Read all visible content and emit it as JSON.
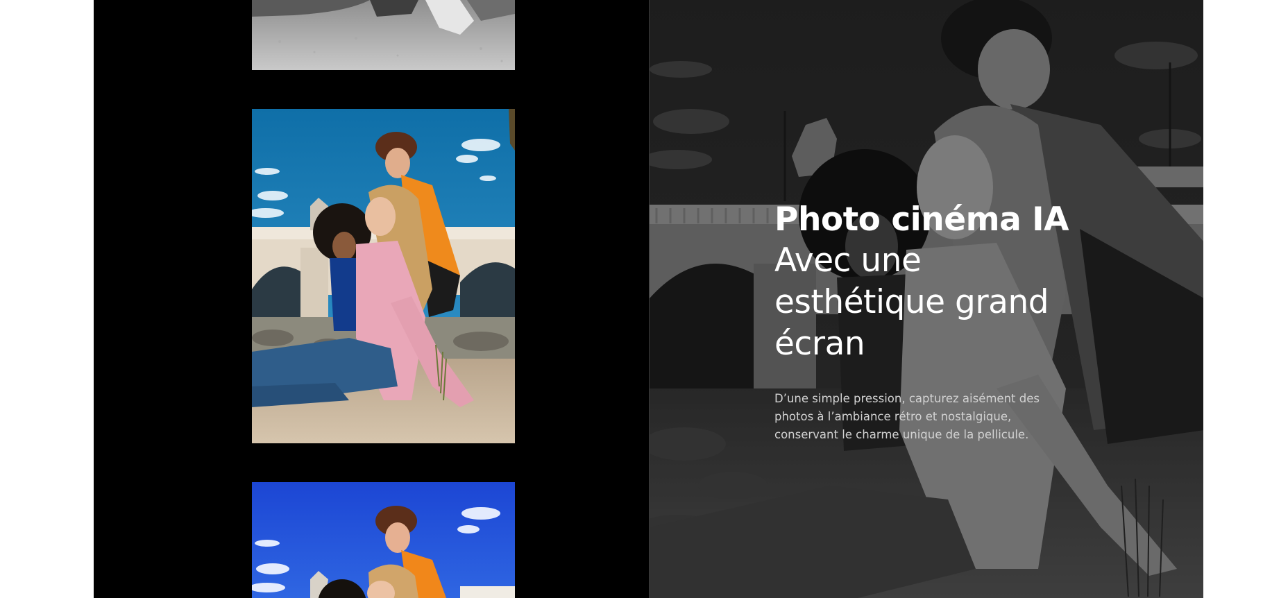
{
  "hero": {
    "title": "Photo cinéma IA",
    "subtitle": "Avec une esthétique grand écran",
    "description": "D’une simple pression, capturez aisément des photos à l’ambiance rétro et nostalgique, conservant le charme unique de la pellicule."
  },
  "filmstrip": {
    "frames": [
      {
        "style": "black-and-white"
      },
      {
        "style": "warm-color"
      },
      {
        "style": "vivid-blue"
      }
    ]
  },
  "colors": {
    "stage_background": "#000000",
    "page_background": "#ffffff",
    "title_text": "#ffffff",
    "description_text": "#d2d2d2",
    "sky_warm": "#1b84b9",
    "sky_vivid": "#1f4fd8",
    "orange_shirt": "#ef8a1c",
    "pink_sweater": "#e9a7b8"
  },
  "icons": []
}
